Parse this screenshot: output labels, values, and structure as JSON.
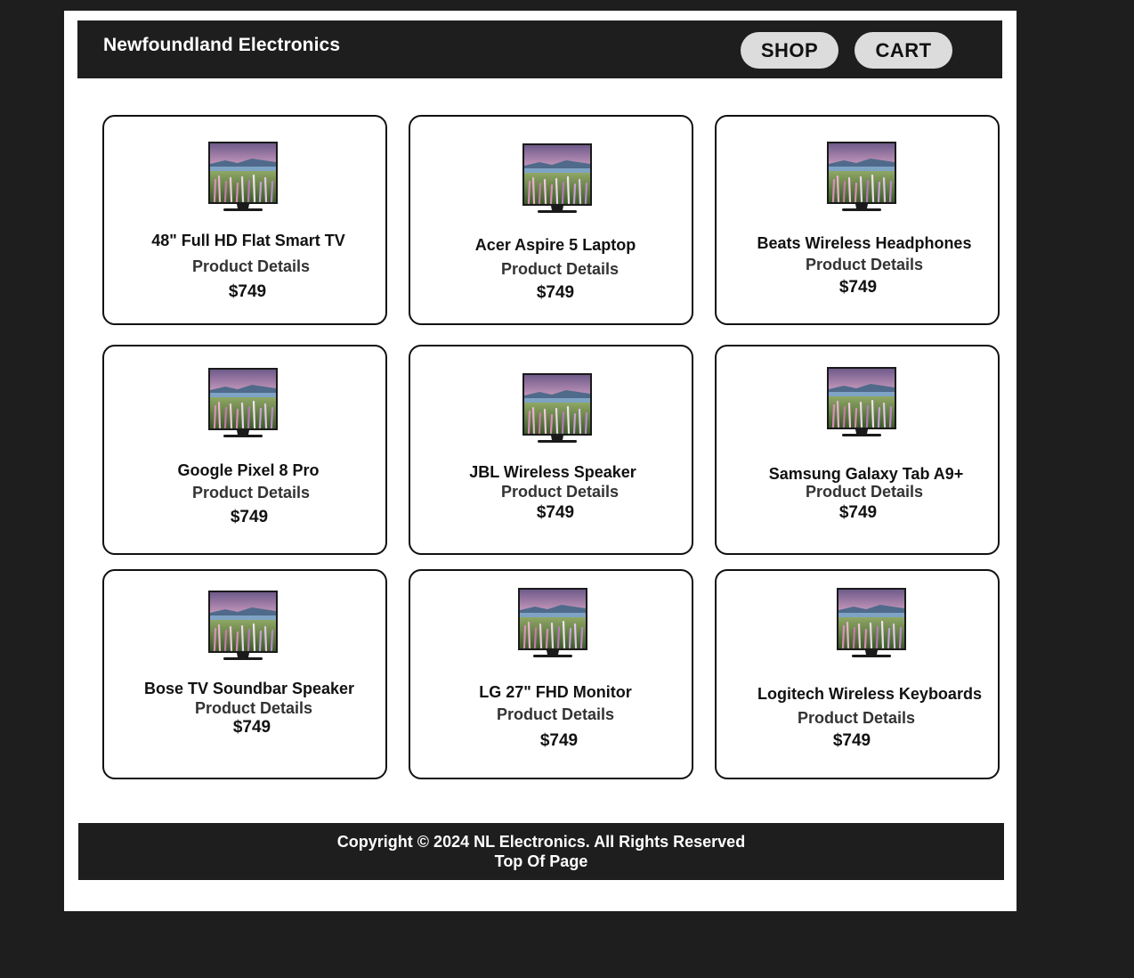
{
  "header": {
    "brand": "Newfoundland Electronics",
    "nav": [
      {
        "label": "SHOP"
      },
      {
        "label": "CART"
      }
    ]
  },
  "products": [
    {
      "name": "48\" Full HD Flat Smart TV",
      "details_label": "Product Details",
      "price": "$749"
    },
    {
      "name": "Acer Aspire 5 Laptop",
      "details_label": "Product Details",
      "price": "$749"
    },
    {
      "name": "Beats Wireless Headphones",
      "details_label": "Product Details",
      "price": "$749"
    },
    {
      "name": "Google Pixel 8 Pro",
      "details_label": "Product Details",
      "price": "$749"
    },
    {
      "name": "JBL Wireless Speaker",
      "details_label": "Product Details",
      "price": "$749"
    },
    {
      "name": "Samsung Galaxy Tab A9+",
      "details_label": "Product Details",
      "price": "$749"
    },
    {
      "name": "Bose TV Soundbar Speaker",
      "details_label": "Product Details",
      "price": "$749"
    },
    {
      "name": "LG 27\" FHD Monitor",
      "details_label": "Product Details",
      "price": "$749"
    },
    {
      "name": "Logitech Wireless Keyboards",
      "details_label": "Product Details",
      "price": "$749"
    }
  ],
  "product_image_icon": "tv-product-image",
  "footer": {
    "copyright": "Copyright © 2024 NL Electronics. All Rights Reserved",
    "top_link": "Top Of Page"
  },
  "colors": {
    "background": "#1e1e1e",
    "page": "#ffffff",
    "nav_button": "#dcdcdc"
  }
}
